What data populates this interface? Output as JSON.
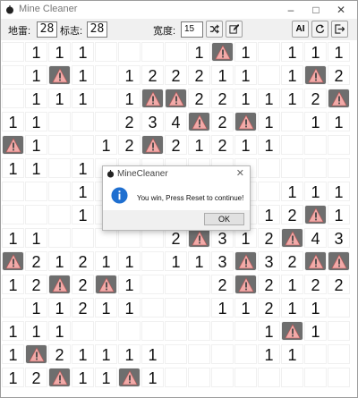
{
  "window": {
    "title": "Mine Cleaner",
    "minimize_icon": "minimize-icon",
    "maximize_icon": "maximize-icon",
    "close_icon": "close-icon"
  },
  "toolbar": {
    "mines_label": "地雷:",
    "mines_value": "28",
    "flags_label": "标志:",
    "flags_value": "28",
    "width_label": "宽度:",
    "width_value": "15",
    "shuffle_icon": "shuffle-icon",
    "edit_icon": "edit-icon",
    "ai_label": "AI",
    "reset_icon": "refresh-icon",
    "exit_icon": "exit-icon"
  },
  "board": {
    "rows": [
      [
        "",
        "1",
        "1",
        "1",
        "",
        "",
        "",
        "",
        "1",
        "M",
        "1",
        "",
        "1",
        "1",
        "1"
      ],
      [
        "",
        "1",
        "M",
        "1",
        "",
        "1",
        "2",
        "2",
        "2",
        "1",
        "1",
        "",
        "1",
        "M",
        "2"
      ],
      [
        "",
        "1",
        "1",
        "1",
        "",
        "1",
        "M",
        "M",
        "2",
        "2",
        "1",
        "1",
        "1",
        "2",
        "M"
      ],
      [
        "1",
        "1",
        "",
        "",
        "",
        "2",
        "3",
        "4",
        "M",
        "2",
        "M",
        "1",
        "",
        "1",
        "1"
      ],
      [
        "M",
        "1",
        "",
        "",
        "1",
        "2",
        "M",
        "2",
        "1",
        "2",
        "1",
        "1",
        "",
        "",
        ""
      ],
      [
        "1",
        "1",
        "",
        "1",
        "",
        "",
        "",
        "",
        "",
        "",
        "",
        "",
        "",
        "",
        ""
      ],
      [
        "",
        "",
        "",
        "1",
        "",
        "",
        "",
        "",
        "",
        "",
        "",
        "",
        "1",
        "1",
        "1"
      ],
      [
        "",
        "",
        "",
        "1",
        "",
        "",
        "",
        "",
        "",
        "",
        "",
        "1",
        "2",
        "M",
        "1"
      ],
      [
        "1",
        "1",
        "",
        "",
        "",
        "",
        "",
        "2",
        "M",
        "3",
        "1",
        "2",
        "M",
        "4",
        "3"
      ],
      [
        "M",
        "2",
        "1",
        "2",
        "1",
        "1",
        "",
        "1",
        "1",
        "3",
        "M",
        "3",
        "2",
        "M",
        "M"
      ],
      [
        "1",
        "2",
        "M",
        "2",
        "M",
        "1",
        "",
        "",
        "",
        "2",
        "M",
        "2",
        "1",
        "2",
        "2"
      ],
      [
        "",
        "1",
        "1",
        "2",
        "1",
        "1",
        "",
        "",
        "",
        "1",
        "1",
        "2",
        "1",
        "1",
        ""
      ],
      [
        "1",
        "1",
        "1",
        "",
        "",
        "",
        "",
        "",
        "",
        "",
        "",
        "1",
        "M",
        "1",
        ""
      ],
      [
        "1",
        "M",
        "2",
        "1",
        "1",
        "1",
        "1",
        "",
        "",
        "",
        "",
        "1",
        "1",
        "",
        ""
      ],
      [
        "1",
        "2",
        "M",
        "1",
        "1",
        "M",
        "1",
        "",
        "",
        "",
        "",
        "",
        "",
        "",
        ""
      ]
    ]
  },
  "dialog": {
    "title": "MineCleaner",
    "message": "You win, Press Reset to continue!",
    "ok_label": "OK",
    "info_icon": "info-icon",
    "close_icon": "close-icon"
  },
  "colors": {
    "mine_cell_bg": "#6e6e6e",
    "mine_icon_fill": "#f2aaa8",
    "info_icon_fill": "#1f6fd0"
  }
}
